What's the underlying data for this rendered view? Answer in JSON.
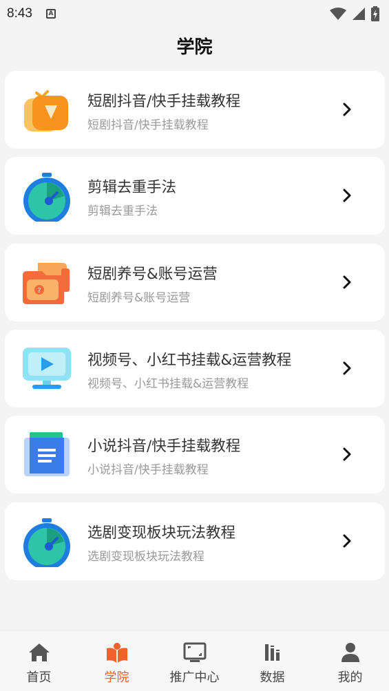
{
  "status_bar": {
    "time": "8:43",
    "notification_letter": "A"
  },
  "header": {
    "title": "学院"
  },
  "courses": [
    {
      "title": "短剧抖音/快手挂载教程",
      "subtitle": "短剧抖音/快手挂载教程",
      "icon": "play-box-icon"
    },
    {
      "title": "剪辑去重手法",
      "subtitle": "剪辑去重手法",
      "icon": "stopwatch-icon"
    },
    {
      "title": "短剧养号&账号运营",
      "subtitle": "短剧养号&账号运营",
      "icon": "folder-account-icon"
    },
    {
      "title": "视频号、小红书挂载&运营教程",
      "subtitle": "视频号、小红书挂载&运营教程",
      "icon": "monitor-play-icon"
    },
    {
      "title": "小说抖音/快手挂载教程",
      "subtitle": "小说抖音/快手挂载教程",
      "icon": "document-icon"
    },
    {
      "title": "选剧变现板块玩法教程",
      "subtitle": "选剧变现板块玩法教程",
      "icon": "stopwatch-icon"
    }
  ],
  "tabs": [
    {
      "label": "首页",
      "icon": "home-icon",
      "active": false
    },
    {
      "label": "学院",
      "icon": "book-icon",
      "active": true
    },
    {
      "label": "推广中心",
      "icon": "screen-icon",
      "active": false
    },
    {
      "label": "数据",
      "icon": "bar-chart-icon",
      "active": false
    },
    {
      "label": "我的",
      "icon": "user-icon",
      "active": false
    }
  ],
  "colors": {
    "accent": "#f0612e",
    "card_bg": "#ffffff",
    "page_bg": "#f4f4f4",
    "subtitle": "#9a9a9a"
  }
}
